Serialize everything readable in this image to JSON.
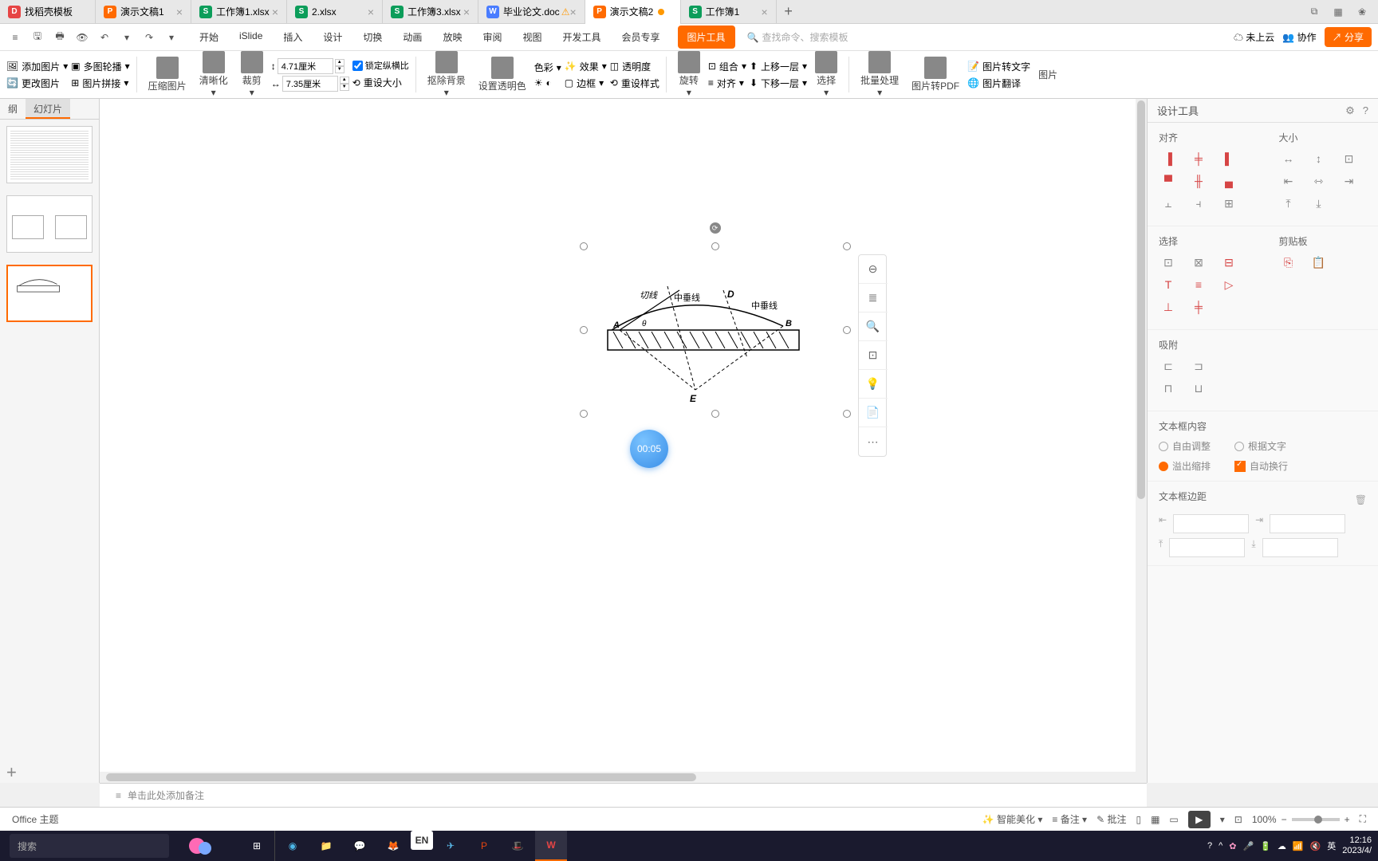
{
  "tabs": [
    {
      "icon": "docer",
      "label": "找稻壳模板",
      "iconChar": "D"
    },
    {
      "icon": "ppt",
      "label": "演示文稿1",
      "iconChar": "P"
    },
    {
      "icon": "xls",
      "label": "工作簿1.xlsx",
      "iconChar": "S"
    },
    {
      "icon": "xls",
      "label": "2.xlsx",
      "iconChar": "S"
    },
    {
      "icon": "xls",
      "label": "工作簿3.xlsx",
      "iconChar": "S"
    },
    {
      "icon": "doc",
      "label": "毕业论文.doc",
      "iconChar": "W",
      "warn": true
    },
    {
      "icon": "ppt",
      "label": "演示文稿2",
      "iconChar": "P",
      "active": true,
      "modified": true
    },
    {
      "icon": "xls",
      "label": "工作簿1",
      "iconChar": "S"
    }
  ],
  "qat": {
    "undo": "↶",
    "redo": "↷"
  },
  "menu": [
    "开始",
    "iSlide",
    "插入",
    "设计",
    "切换",
    "动画",
    "放映",
    "审阅",
    "视图",
    "开发工具",
    "会员专享"
  ],
  "contextTab": "图片工具",
  "searchPlaceholder": "查找命令、搜索模板",
  "ribbonRight": {
    "cloud": "未上云",
    "collab": "协作",
    "share": "分享"
  },
  "toolbar": {
    "addImage": "添加图片",
    "carousel": "多图轮播",
    "changeImage": "更改图片",
    "imageStitch": "图片拼接",
    "compress": "压缩图片",
    "clarity": "清晰化",
    "crop": "裁剪",
    "height": "4.71厘米",
    "width": "7.35厘米",
    "lockRatio": "锁定纵横比",
    "resetSize": "重设大小",
    "removeBg": "抠除背景",
    "setTransparent": "设置透明色",
    "colorFx": "色彩",
    "effect": "效果",
    "transparency": "透明度",
    "border": "边框",
    "setStyle": "重设样式",
    "rotate": "旋转",
    "group": "组合",
    "moveUp": "上移一层",
    "align": "对齐",
    "moveDown": "下移一层",
    "select": "选择",
    "batch": "批量处理",
    "toPdf": "图片转PDF",
    "toText": "图片转文字",
    "translate": "图片翻译",
    "more": "图片"
  },
  "slideTabs": {
    "outline": "纲",
    "slides": "幻灯片"
  },
  "timer": "00:05",
  "diagram": {
    "qiexian": "切线",
    "zhongchuxian1": "中垂线",
    "zhongchuxian2": "中垂线",
    "A": "A",
    "B": "B",
    "D": "D",
    "E": "E",
    "theta": "θ"
  },
  "designPanel": {
    "title": "设计工具",
    "align": "对齐",
    "size": "大小",
    "select": "选择",
    "clipboard": "剪贴板",
    "adsorb": "吸附",
    "textContent": "文本框内容",
    "textMargin": "文本框边距",
    "autoAdjust": "自由调整",
    "byText": "根据文字",
    "overflow": "溢出缩排",
    "autoWrap": "自动换行"
  },
  "notesPlaceholder": "单击此处添加备注",
  "statusBar": {
    "theme": "Office 主题",
    "smartBeautify": "智能美化",
    "notes": "备注",
    "comments": "批注",
    "zoom": "100%"
  },
  "taskbar": {
    "search": "搜索",
    "ime": "英",
    "time": "12:16",
    "date": "2023/4/"
  }
}
